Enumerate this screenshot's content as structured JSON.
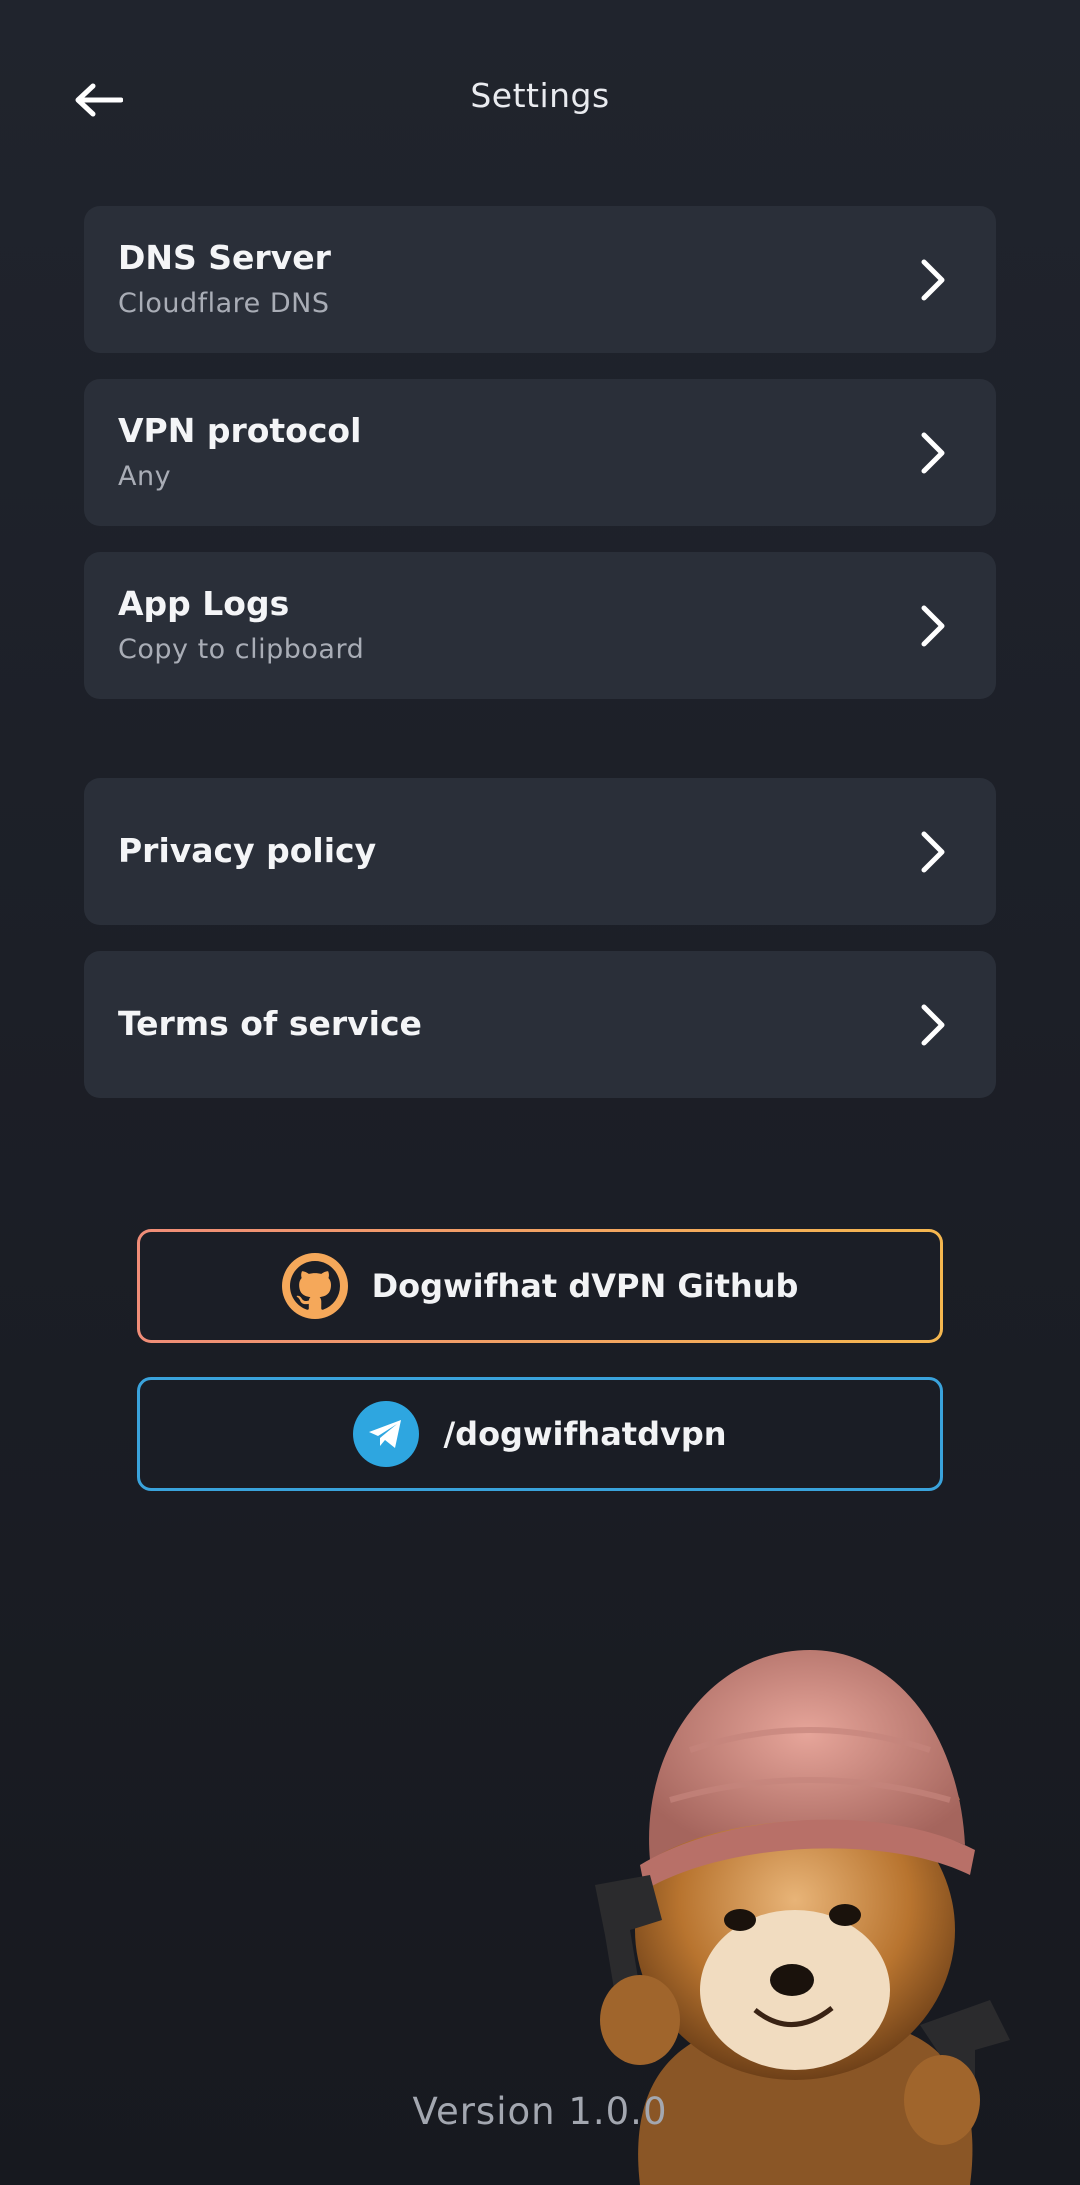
{
  "header": {
    "title": "Settings",
    "back_icon": "arrow-left-icon"
  },
  "settings": [
    {
      "title": "DNS Server",
      "subtitle": "Cloudflare DNS"
    },
    {
      "title": "VPN protocol",
      "subtitle": "Any"
    },
    {
      "title": "App Logs",
      "subtitle": "Copy to clipboard"
    }
  ],
  "legal": [
    {
      "title": "Privacy policy"
    },
    {
      "title": "Terms of service"
    }
  ],
  "links": {
    "github": {
      "label": "Dogwifhat dVPN Github",
      "icon": "github-icon",
      "border_colors": [
        "#f08d78",
        "#f5b74f"
      ]
    },
    "telegram": {
      "label": "/dogwifhatdvpn",
      "icon": "telegram-icon",
      "border_color": "#3aa3dc"
    }
  },
  "footer": {
    "version": "Version 1.0.0"
  },
  "colors": {
    "background": "#1f232b",
    "card": "#2a2f39"
  }
}
